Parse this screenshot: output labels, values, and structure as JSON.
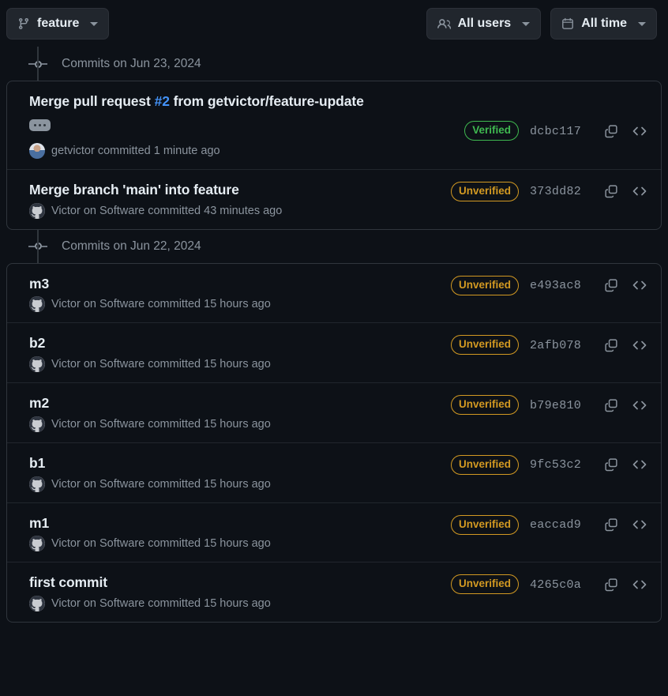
{
  "toolbar": {
    "branch": {
      "label": "feature",
      "icon": "git-branch-icon"
    },
    "users_filter": {
      "label": "All users",
      "icon": "people-icon"
    },
    "time_filter": {
      "label": "All time",
      "icon": "calendar-icon"
    }
  },
  "groups": [
    {
      "date_label": "Commits on Jun 23, 2024",
      "commits": [
        {
          "title_before": "Merge pull request ",
          "title_link": "#2",
          "title_after": " from getvictor/feature-update",
          "has_expand": true,
          "expand_label": "…",
          "author": "getvictor",
          "meta": "getvictor committed 1 minute ago",
          "avatar": "photo",
          "verification": "Verified",
          "verified": true,
          "sha": "dcbc117",
          "copy_icon": "copy-icon",
          "code_icon": "code-icon"
        },
        {
          "title_before": "Merge branch 'main' into feature",
          "title_link": "",
          "title_after": "",
          "has_expand": false,
          "author": "Victor on Software",
          "meta": "Victor on Software committed 43 minutes ago",
          "avatar": "octocat",
          "verification": "Unverified",
          "verified": false,
          "sha": "373dd82",
          "copy_icon": "copy-icon",
          "code_icon": "code-icon"
        }
      ]
    },
    {
      "date_label": "Commits on Jun 22, 2024",
      "commits": [
        {
          "title_before": "m3",
          "title_link": "",
          "title_after": "",
          "has_expand": false,
          "author": "Victor on Software",
          "meta": "Victor on Software committed 15 hours ago",
          "avatar": "octocat",
          "verification": "Unverified",
          "verified": false,
          "sha": "e493ac8",
          "copy_icon": "copy-icon",
          "code_icon": "code-icon"
        },
        {
          "title_before": "b2",
          "title_link": "",
          "title_after": "",
          "has_expand": false,
          "author": "Victor on Software",
          "meta": "Victor on Software committed 15 hours ago",
          "avatar": "octocat",
          "verification": "Unverified",
          "verified": false,
          "sha": "2afb078",
          "copy_icon": "copy-icon",
          "code_icon": "code-icon"
        },
        {
          "title_before": "m2",
          "title_link": "",
          "title_after": "",
          "has_expand": false,
          "author": "Victor on Software",
          "meta": "Victor on Software committed 15 hours ago",
          "avatar": "octocat",
          "verification": "Unverified",
          "verified": false,
          "sha": "b79e810",
          "copy_icon": "copy-icon",
          "code_icon": "code-icon"
        },
        {
          "title_before": "b1",
          "title_link": "",
          "title_after": "",
          "has_expand": false,
          "author": "Victor on Software",
          "meta": "Victor on Software committed 15 hours ago",
          "avatar": "octocat",
          "verification": "Unverified",
          "verified": false,
          "sha": "9fc53c2",
          "copy_icon": "copy-icon",
          "code_icon": "code-icon"
        },
        {
          "title_before": "m1",
          "title_link": "",
          "title_after": "",
          "has_expand": false,
          "author": "Victor on Software",
          "meta": "Victor on Software committed 15 hours ago",
          "avatar": "octocat",
          "verification": "Unverified",
          "verified": false,
          "sha": "eaccad9",
          "copy_icon": "copy-icon",
          "code_icon": "code-icon"
        },
        {
          "title_before": "first commit",
          "title_link": "",
          "title_after": "",
          "has_expand": false,
          "author": "Victor on Software",
          "meta": "Victor on Software committed 15 hours ago",
          "avatar": "octocat",
          "verification": "Unverified",
          "verified": false,
          "sha": "4265c0a",
          "copy_icon": "copy-icon",
          "code_icon": "code-icon"
        }
      ]
    }
  ],
  "colors": {
    "background": "#0d1117",
    "border": "#30363d",
    "link": "#4493f8",
    "verified": "#3fb950",
    "unverified": "#d29922",
    "muted": "#8b949e"
  }
}
